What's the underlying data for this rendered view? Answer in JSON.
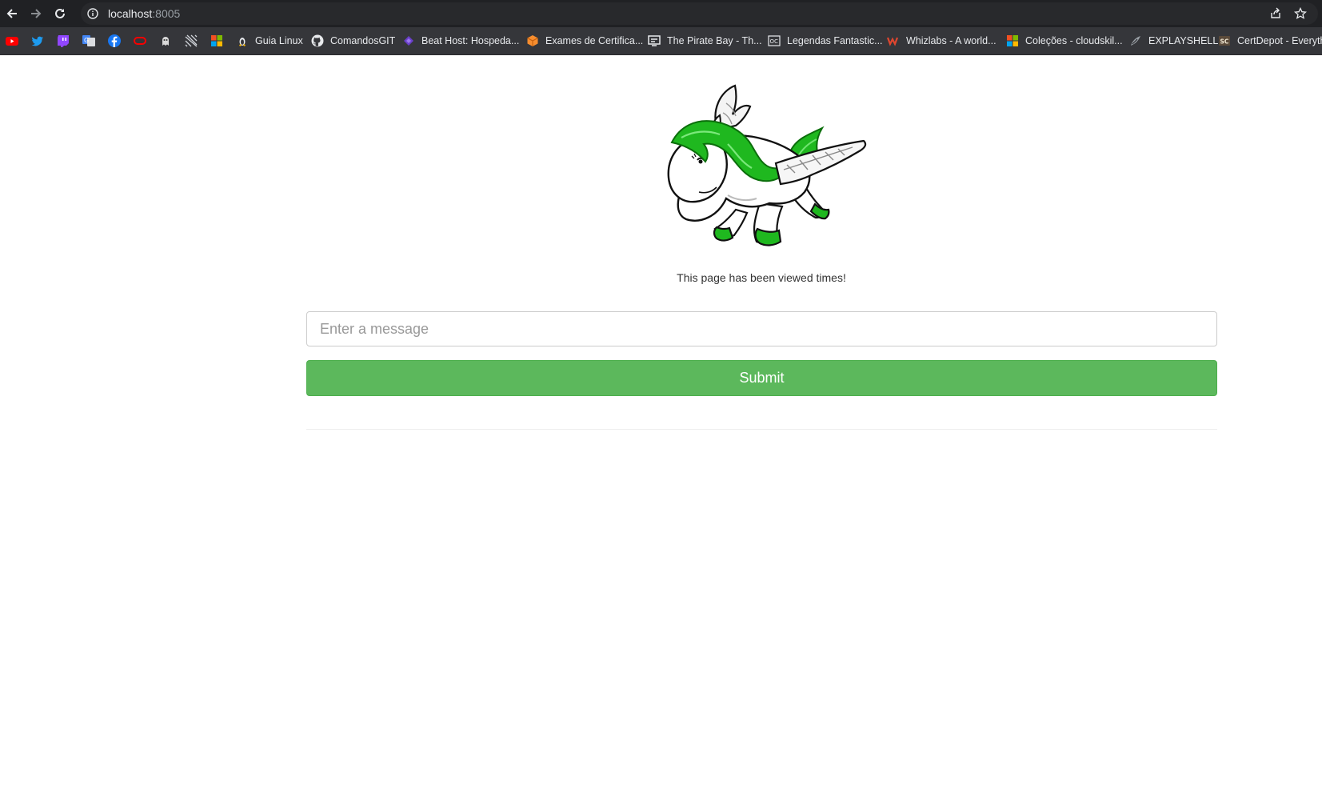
{
  "browser": {
    "url_host": "localhost",
    "url_port": ":8005",
    "bookmarks": [
      {
        "label": "",
        "icon": "youtube-icon"
      },
      {
        "label": "",
        "icon": "twitter-icon"
      },
      {
        "label": "",
        "icon": "twitch-icon"
      },
      {
        "label": "",
        "icon": "google-translate-icon"
      },
      {
        "label": "",
        "icon": "facebook-icon"
      },
      {
        "label": "",
        "icon": "oracle-icon"
      },
      {
        "label": "",
        "icon": "ghost-icon"
      },
      {
        "label": "",
        "icon": "grid-pattern-icon"
      },
      {
        "label": "",
        "icon": "microsoft-icon"
      },
      {
        "label": "Guia Linux",
        "icon": "linux-icon"
      },
      {
        "label": "ComandosGIT",
        "icon": "github-icon"
      },
      {
        "label": "Beat Host: Hospeda...",
        "icon": "beathost-icon"
      },
      {
        "label": "Exames de Certifica...",
        "icon": "aws-cube-icon"
      },
      {
        "label": "The Pirate Bay - Th...",
        "icon": "pirate-bay-icon"
      },
      {
        "label": "Legendas Fantastic...",
        "icon": "legendas-icon"
      },
      {
        "label": "Whizlabs - A world...",
        "icon": "whizlabs-icon"
      },
      {
        "label": "Coleções - cloudskil...",
        "icon": "microsoft-icon"
      },
      {
        "label": "EXPLAYSHELL",
        "icon": "explainshell-icon"
      },
      {
        "label": "CertDepot - Everyth",
        "icon": "certdepot-icon"
      }
    ]
  },
  "page": {
    "view_text": "This page has been viewed times!",
    "input_placeholder": "Enter a message",
    "submit_label": "Submit"
  },
  "colors": {
    "submit_bg": "#5cb85c",
    "mane_green": "#1fb81f",
    "browser_bg": "#202124"
  }
}
